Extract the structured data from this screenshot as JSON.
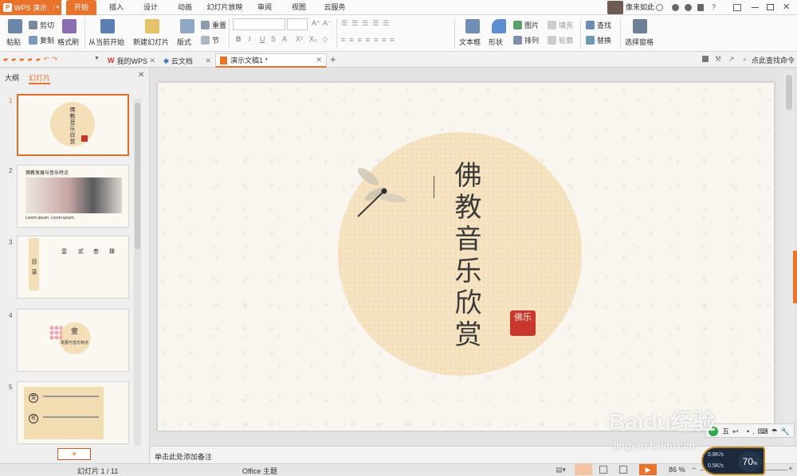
{
  "titlebar": {
    "app_name": "WPS 演示",
    "tabs": [
      "开始",
      "插入",
      "设计",
      "动画",
      "幻灯片放映",
      "审阅",
      "视图",
      "云服务"
    ],
    "user": "像来如此",
    "help": "?"
  },
  "ribbon": {
    "paste": "粘贴",
    "cut": "剪切",
    "copy": "复制",
    "format_painter": "格式刷",
    "from_current": "从当前开始",
    "new_slide": "新建幻灯片",
    "layout": "版式",
    "reset": "重置",
    "section": "节",
    "font_name": "",
    "font_size": "",
    "bold": "B",
    "italic": "I",
    "underline": "U",
    "strike": "S",
    "superscript": "X²",
    "subscript": "X₂",
    "textbox": "文本框",
    "shape": "形状",
    "picture": "图片",
    "fill": "填充",
    "arrange": "排列",
    "outline": "轮廓",
    "find": "查找",
    "replace": "替换",
    "selection_pane": "选择窗格"
  },
  "doctabs": [
    {
      "label": "我的WPS"
    },
    {
      "label": "云文档"
    },
    {
      "label": "演示文稿1 *"
    }
  ],
  "search_cmd": "点此查找命令",
  "leftpane": {
    "tab_outline": "大纲",
    "tab_slides": "幻灯片",
    "thumbs": [
      {
        "num": "1"
      },
      {
        "num": "2",
        "title": "佛教发展与音乐特点",
        "caption": "Lorem ipsum. Lorem ipsum."
      },
      {
        "num": "3",
        "title": "目录",
        "chapters": [
          "壹",
          "贰",
          "叁",
          "肆"
        ]
      },
      {
        "num": "4",
        "title": "壹",
        "subtitle": "发展与音乐特点"
      },
      {
        "num": "5",
        "items": [
          "壹",
          "贰"
        ]
      }
    ],
    "add_button": "+"
  },
  "slide": {
    "title": "佛教音乐欣赏",
    "seal": "佛乐"
  },
  "notes_placeholder": "单击此处添加备注",
  "status": {
    "slide_info": "幻灯片 1 / 11",
    "theme": "Office 主题",
    "zoom": "86 %"
  },
  "widget": {
    "up": "0.8K/s",
    "down": "0.5K/s",
    "percent": "70",
    "percent_sign": "%"
  },
  "watermark": {
    "brand": "Baidu经验",
    "url": "jingyan.baidu.com"
  },
  "colors": {
    "accent": "#e9732a",
    "circle": "#f6e3c1",
    "seal": "#c8372d"
  }
}
